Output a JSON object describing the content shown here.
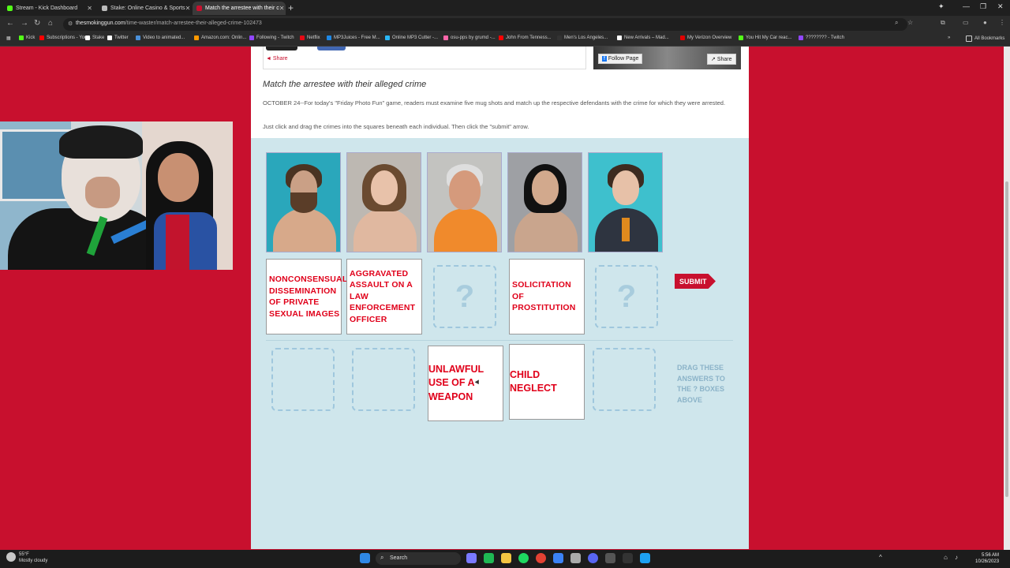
{
  "browser": {
    "tabs": [
      {
        "label": "Stream - Kick Dashboard",
        "color": "#53fc18"
      },
      {
        "label": "Stake: Online Casino & Sports",
        "color": "#bbbbbb"
      },
      {
        "label": "Match the arrestee with their c",
        "color": "#c8102e",
        "active": true
      }
    ],
    "url_domain": "thesmokinggun.com",
    "url_path": "/time-waster/match-arrestee-their-alleged-crime-102473",
    "bookmarks": [
      {
        "label": "Kick",
        "color": "#53fc18"
      },
      {
        "label": "Subscriptions - You...",
        "color": "#ff0000"
      },
      {
        "label": "Stake",
        "color": "#ffffff"
      },
      {
        "label": "Twitter",
        "color": "#ffffff"
      },
      {
        "label": "Video to animated...",
        "color": "#4a90d9"
      },
      {
        "label": "Amazon.com: Onlin...",
        "color": "#ff9900"
      },
      {
        "label": "Following - Twitch",
        "color": "#9146ff"
      },
      {
        "label": "Netflix",
        "color": "#e50914"
      },
      {
        "label": "MP3Juices - Free M...",
        "color": "#1e88e5"
      },
      {
        "label": "Online MP3 Cutter -...",
        "color": "#29b6f6"
      },
      {
        "label": "osu-pps by grumd -...",
        "color": "#ff66aa"
      },
      {
        "label": "John From Tenness...",
        "color": "#ff0000"
      },
      {
        "label": "Men's Los Angeles...",
        "color": "#333333"
      },
      {
        "label": "New Arrivals – Mad...",
        "color": "#ffffff"
      },
      {
        "label": "My Verizon Overview",
        "color": "#e00000"
      },
      {
        "label": "You Hit My Car reac...",
        "color": "#53fc18"
      },
      {
        "label": "???????? - Twitch",
        "color": "#9146ff"
      }
    ],
    "all_bookmarks": "All Bookmarks"
  },
  "article": {
    "share_label": "Share",
    "fb_follow": "Follow Page",
    "fb_share": "Share",
    "title": "Match the arrestee with their alleged crime",
    "description": "OCTOBER 24--For today's \"Friday Photo Fun\" game, readers must examine five mug shots and match up the respective defendants with the crime for which they were arrested.",
    "instructions": "Just click and drag the crimes into the squares beneath each individual. Then click the \"submit\" arrow."
  },
  "game": {
    "placed": [
      {
        "label": "NONCONSENSUAL DISSEMINATION OF PRIVATE SEXUAL IMAGES"
      },
      {
        "label": "AGGRAVATED ASSAULT ON A LAW ENFORCEMENT OFFICER"
      },
      {
        "label": "?"
      },
      {
        "label": "SOLICITATION OF PROSTITUTION"
      },
      {
        "label": "?"
      }
    ],
    "answers": [
      "UNLAWFUL USE OF A WEAPON",
      "CHILD NEGLECT"
    ],
    "submit_label": "SUBMIT",
    "drag_hint": "DRAG THESE ANSWERS TO THE ? BOXES ABOVE"
  },
  "taskbar": {
    "search_label": "Search",
    "weather_temp": "55°F",
    "weather_desc": "Mostly cloudy",
    "time": "5:56 AM",
    "date": "10/26/2023"
  }
}
